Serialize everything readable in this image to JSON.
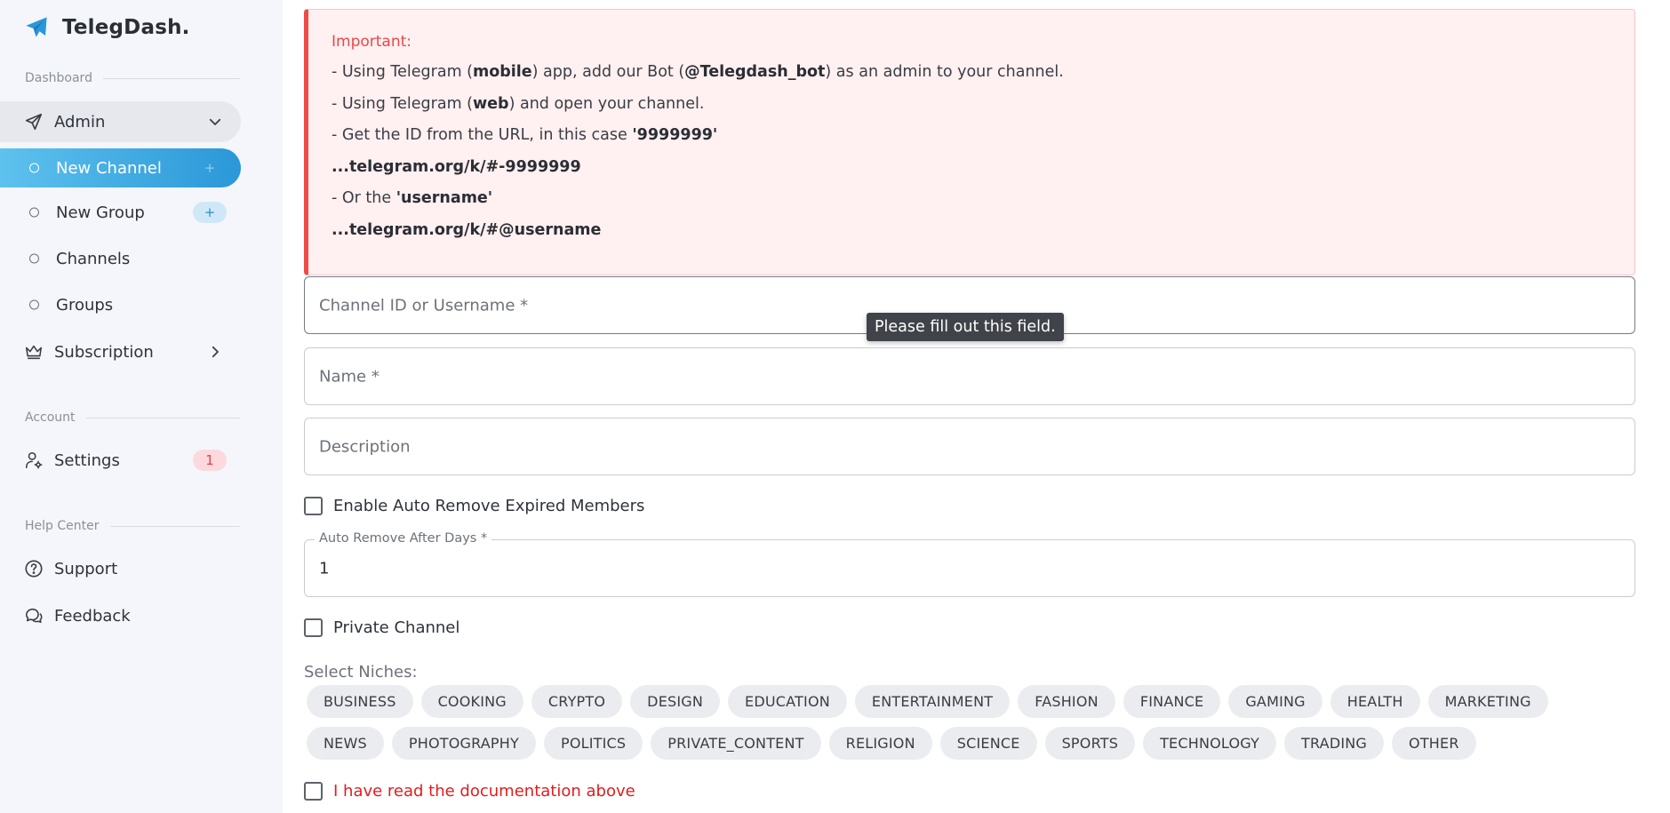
{
  "brand": {
    "name": "TelegDash."
  },
  "sidebar": {
    "section_dashboard": "Dashboard",
    "admin": {
      "label": "Admin"
    },
    "admin_items": [
      {
        "label": "New Channel",
        "badge": "+"
      },
      {
        "label": "New Group",
        "badge": "+"
      },
      {
        "label": "Channels"
      },
      {
        "label": "Groups"
      }
    ],
    "subscription": {
      "label": "Subscription"
    },
    "section_account": "Account",
    "settings": {
      "label": "Settings",
      "badge": "1"
    },
    "section_help": "Help Center",
    "support": {
      "label": "Support"
    },
    "feedback": {
      "label": "Feedback"
    }
  },
  "alert": {
    "title": "Important:",
    "line1": {
      "a": "- Using Telegram (",
      "b": "mobile",
      "c": ") app, add our Bot (",
      "d": "@Telegdash_bot",
      "e": ") as an admin to your channel."
    },
    "line2": {
      "a": "- Using Telegram (",
      "b": "web",
      "c": ") and open your channel."
    },
    "line3": {
      "a": "- Get the ID from the URL, in this case ",
      "b": "'9999999'"
    },
    "line4": "...telegram.org/k/#-9999999",
    "line5": {
      "a": "- Or the ",
      "b": "'username'"
    },
    "line6": "...telegram.org/k/#@username"
  },
  "form": {
    "channel_id_placeholder": "Channel ID or Username *",
    "tooltip": "Please fill out this field.",
    "name_placeholder": "Name *",
    "description_placeholder": "Description",
    "auto_remove_checkbox": "Enable Auto Remove Expired Members",
    "auto_remove_days_label": "Auto Remove After Days *",
    "auto_remove_days_value": "1",
    "private_channel_checkbox": "Private Channel",
    "niches_label": "Select Niches:",
    "niches": [
      "BUSINESS",
      "COOKING",
      "CRYPTO",
      "DESIGN",
      "EDUCATION",
      "ENTERTAINMENT",
      "FASHION",
      "FINANCE",
      "GAMING",
      "HEALTH",
      "MARKETING",
      "NEWS",
      "PHOTOGRAPHY",
      "POLITICS",
      "PRIVATE_CONTENT",
      "RELIGION",
      "SCIENCE",
      "SPORTS",
      "TECHNOLOGY",
      "TRADING",
      "OTHER"
    ],
    "docs_checkbox": "I have read the documentation above"
  },
  "colors": {
    "accent": "#2a97d8",
    "alert_border": "#ef4a48",
    "alert_bg": "#fff0f1",
    "warning_text": "#e11d1d"
  }
}
